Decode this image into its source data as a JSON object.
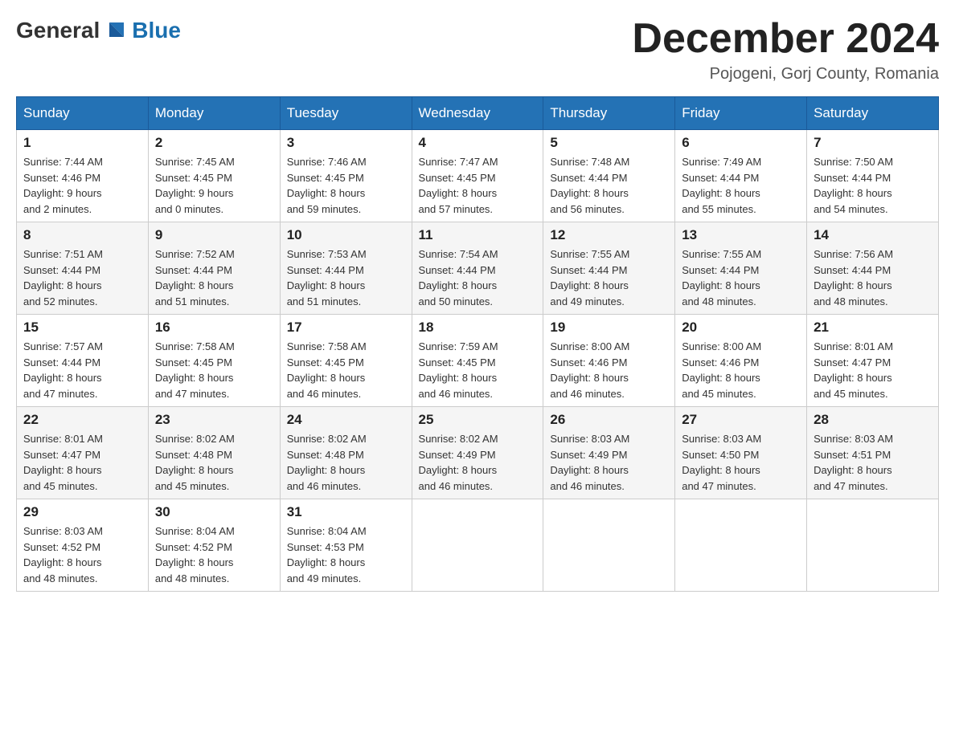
{
  "logo": {
    "general": "General",
    "blue": "Blue"
  },
  "title": "December 2024",
  "location": "Pojogeni, Gorj County, Romania",
  "days_of_week": [
    "Sunday",
    "Monday",
    "Tuesday",
    "Wednesday",
    "Thursday",
    "Friday",
    "Saturday"
  ],
  "weeks": [
    [
      {
        "day": "1",
        "sunrise": "7:44 AM",
        "sunset": "4:46 PM",
        "daylight": "9 hours and 2 minutes."
      },
      {
        "day": "2",
        "sunrise": "7:45 AM",
        "sunset": "4:45 PM",
        "daylight": "9 hours and 0 minutes."
      },
      {
        "day": "3",
        "sunrise": "7:46 AM",
        "sunset": "4:45 PM",
        "daylight": "8 hours and 59 minutes."
      },
      {
        "day": "4",
        "sunrise": "7:47 AM",
        "sunset": "4:45 PM",
        "daylight": "8 hours and 57 minutes."
      },
      {
        "day": "5",
        "sunrise": "7:48 AM",
        "sunset": "4:44 PM",
        "daylight": "8 hours and 56 minutes."
      },
      {
        "day": "6",
        "sunrise": "7:49 AM",
        "sunset": "4:44 PM",
        "daylight": "8 hours and 55 minutes."
      },
      {
        "day": "7",
        "sunrise": "7:50 AM",
        "sunset": "4:44 PM",
        "daylight": "8 hours and 54 minutes."
      }
    ],
    [
      {
        "day": "8",
        "sunrise": "7:51 AM",
        "sunset": "4:44 PM",
        "daylight": "8 hours and 52 minutes."
      },
      {
        "day": "9",
        "sunrise": "7:52 AM",
        "sunset": "4:44 PM",
        "daylight": "8 hours and 51 minutes."
      },
      {
        "day": "10",
        "sunrise": "7:53 AM",
        "sunset": "4:44 PM",
        "daylight": "8 hours and 51 minutes."
      },
      {
        "day": "11",
        "sunrise": "7:54 AM",
        "sunset": "4:44 PM",
        "daylight": "8 hours and 50 minutes."
      },
      {
        "day": "12",
        "sunrise": "7:55 AM",
        "sunset": "4:44 PM",
        "daylight": "8 hours and 49 minutes."
      },
      {
        "day": "13",
        "sunrise": "7:55 AM",
        "sunset": "4:44 PM",
        "daylight": "8 hours and 48 minutes."
      },
      {
        "day": "14",
        "sunrise": "7:56 AM",
        "sunset": "4:44 PM",
        "daylight": "8 hours and 48 minutes."
      }
    ],
    [
      {
        "day": "15",
        "sunrise": "7:57 AM",
        "sunset": "4:44 PM",
        "daylight": "8 hours and 47 minutes."
      },
      {
        "day": "16",
        "sunrise": "7:58 AM",
        "sunset": "4:45 PM",
        "daylight": "8 hours and 47 minutes."
      },
      {
        "day": "17",
        "sunrise": "7:58 AM",
        "sunset": "4:45 PM",
        "daylight": "8 hours and 46 minutes."
      },
      {
        "day": "18",
        "sunrise": "7:59 AM",
        "sunset": "4:45 PM",
        "daylight": "8 hours and 46 minutes."
      },
      {
        "day": "19",
        "sunrise": "8:00 AM",
        "sunset": "4:46 PM",
        "daylight": "8 hours and 46 minutes."
      },
      {
        "day": "20",
        "sunrise": "8:00 AM",
        "sunset": "4:46 PM",
        "daylight": "8 hours and 45 minutes."
      },
      {
        "day": "21",
        "sunrise": "8:01 AM",
        "sunset": "4:47 PM",
        "daylight": "8 hours and 45 minutes."
      }
    ],
    [
      {
        "day": "22",
        "sunrise": "8:01 AM",
        "sunset": "4:47 PM",
        "daylight": "8 hours and 45 minutes."
      },
      {
        "day": "23",
        "sunrise": "8:02 AM",
        "sunset": "4:48 PM",
        "daylight": "8 hours and 45 minutes."
      },
      {
        "day": "24",
        "sunrise": "8:02 AM",
        "sunset": "4:48 PM",
        "daylight": "8 hours and 46 minutes."
      },
      {
        "day": "25",
        "sunrise": "8:02 AM",
        "sunset": "4:49 PM",
        "daylight": "8 hours and 46 minutes."
      },
      {
        "day": "26",
        "sunrise": "8:03 AM",
        "sunset": "4:49 PM",
        "daylight": "8 hours and 46 minutes."
      },
      {
        "day": "27",
        "sunrise": "8:03 AM",
        "sunset": "4:50 PM",
        "daylight": "8 hours and 47 minutes."
      },
      {
        "day": "28",
        "sunrise": "8:03 AM",
        "sunset": "4:51 PM",
        "daylight": "8 hours and 47 minutes."
      }
    ],
    [
      {
        "day": "29",
        "sunrise": "8:03 AM",
        "sunset": "4:52 PM",
        "daylight": "8 hours and 48 minutes."
      },
      {
        "day": "30",
        "sunrise": "8:04 AM",
        "sunset": "4:52 PM",
        "daylight": "8 hours and 48 minutes."
      },
      {
        "day": "31",
        "sunrise": "8:04 AM",
        "sunset": "4:53 PM",
        "daylight": "8 hours and 49 minutes."
      },
      null,
      null,
      null,
      null
    ]
  ],
  "labels": {
    "sunrise": "Sunrise:",
    "sunset": "Sunset:",
    "daylight": "Daylight:"
  }
}
